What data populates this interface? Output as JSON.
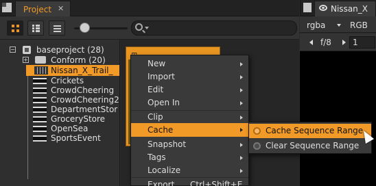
{
  "project_panel": {
    "tab_label": "Project",
    "tab_close": "✕",
    "search_placeholder": ""
  },
  "tree": {
    "root": "baseproject (28)",
    "items": [
      {
        "label": "Conform (20)",
        "type": "bin"
      },
      {
        "label": "Nissan_X_Trail_",
        "type": "sequence",
        "selected": true
      },
      {
        "label": "Crickets",
        "type": "clip"
      },
      {
        "label": "CrowdCheering",
        "type": "clip"
      },
      {
        "label": "CrowdCheering2",
        "type": "clip"
      },
      {
        "label": "DepartmentStor",
        "type": "clip"
      },
      {
        "label": "GroceryStore",
        "type": "clip"
      },
      {
        "label": "OpenSea",
        "type": "clip"
      },
      {
        "label": "SportsEvent",
        "type": "clip"
      }
    ]
  },
  "viewer": {
    "tab_label": "Nissan_X",
    "channels": "rgba",
    "display": "RGB",
    "fstop": "f/8",
    "frame": "1"
  },
  "context_menu": {
    "items": [
      {
        "label": "New",
        "submenu": true
      },
      {
        "label": "Import",
        "submenu": true
      },
      {
        "label": "Edit",
        "submenu": true
      },
      {
        "label": "Open In",
        "submenu": true
      },
      {
        "label": "Clip",
        "submenu": true
      },
      {
        "label": "Cache",
        "submenu": true,
        "highlighted": true
      },
      {
        "label": "Snapshot",
        "submenu": true
      },
      {
        "label": "Tags",
        "submenu": true
      },
      {
        "label": "Localize",
        "submenu": true
      },
      {
        "label": "Export",
        "shortcut": "Ctrl+Shift+E"
      }
    ]
  },
  "cache_submenu": {
    "items": [
      {
        "label": "Cache Sequence Range",
        "highlighted": true
      },
      {
        "label": "Clear Sequence Range"
      }
    ]
  },
  "colors": {
    "accent": "#f29a27",
    "panel_bg": "#2b2b2b",
    "menu_bg": "#3a3a3a"
  }
}
